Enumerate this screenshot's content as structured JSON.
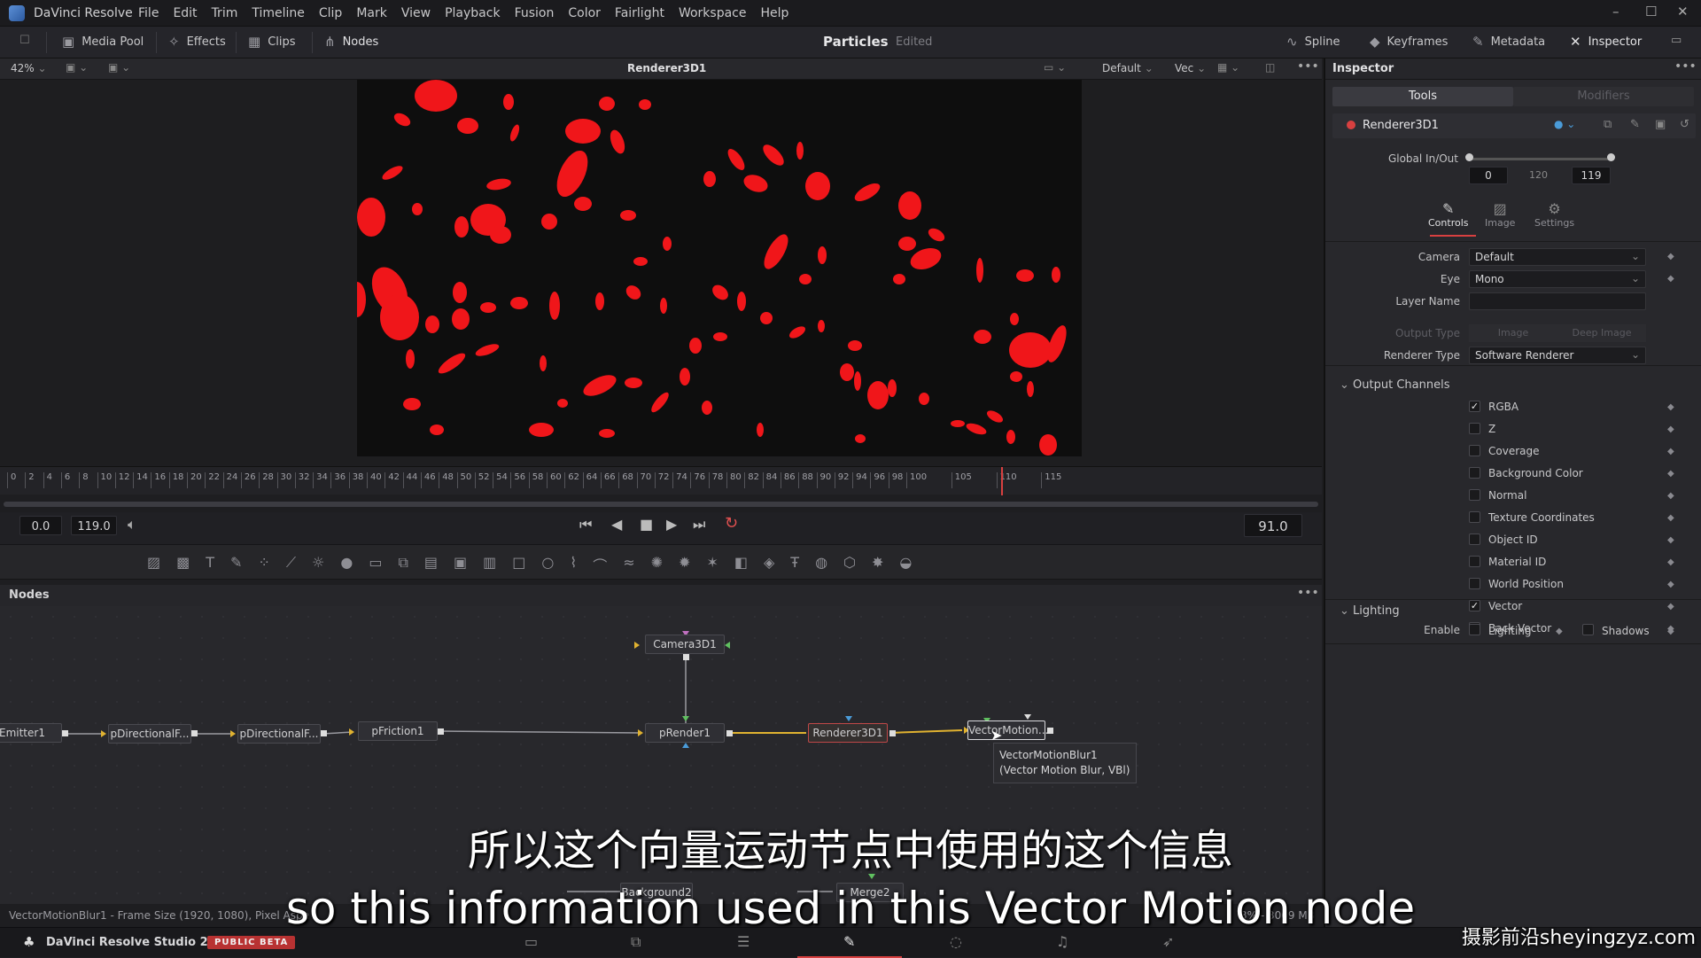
{
  "app": {
    "name": "DaVinci Resolve",
    "menus": [
      "File",
      "Edit",
      "Trim",
      "Timeline",
      "Clip",
      "Mark",
      "View",
      "Playback",
      "Fusion",
      "Color",
      "Fairlight",
      "Workspace",
      "Help"
    ]
  },
  "toolbar": {
    "media_pool": "Media Pool",
    "effects": "Effects",
    "clips": "Clips",
    "nodes": "Nodes",
    "project_title": "Particles",
    "project_status": "Edited",
    "spline": "Spline",
    "keyframes": "Keyframes",
    "metadata": "Metadata",
    "inspector": "Inspector"
  },
  "viewer": {
    "zoom": "42%",
    "title": "Renderer3D1",
    "lut": "Default",
    "vec": "Vec"
  },
  "ruler": {
    "ticks": [
      "0",
      "2",
      "4",
      "6",
      "8",
      "10",
      "12",
      "14",
      "16",
      "18",
      "20",
      "22",
      "24",
      "26",
      "28",
      "30",
      "32",
      "34",
      "36",
      "38",
      "40",
      "42",
      "44",
      "46",
      "48",
      "50",
      "52",
      "54",
      "56",
      "58",
      "60",
      "62",
      "64",
      "66",
      "68",
      "70",
      "72",
      "74",
      "76",
      "78",
      "80",
      "82",
      "84",
      "86",
      "88",
      "90",
      "92",
      "94",
      "96",
      "98",
      "100",
      "105",
      "110",
      "115"
    ]
  },
  "transport": {
    "start": "0.0",
    "end": "119.0",
    "current": "91.0"
  },
  "nodes_panel": {
    "title": "Nodes",
    "nodes": [
      "Camera3D1",
      "Emitter1",
      "pDirectionalF...",
      "pDirectionalF...",
      "pFriction1",
      "pRender1",
      "Renderer3D1",
      "VectorMotion...",
      "Background2",
      "Merge2"
    ],
    "tooltip_name": "VectorMotionBlur1",
    "tooltip_detail": "(Vector Motion Blur, VBl)"
  },
  "status": {
    "left": "VectorMotionBlur1 - Frame Size (1920, 1080), Pixel Aspe",
    "right": "3% - 3069 MB"
  },
  "bottom": {
    "product": "DaVinci Resolve Studio 20",
    "badge": "PUBLIC BETA"
  },
  "inspector": {
    "title": "Inspector",
    "tab_tools": "Tools",
    "tab_modifiers": "Modifiers",
    "tool_name": "Renderer3D1",
    "global_label": "Global In/Out",
    "global_in": "0",
    "global_mid": "120",
    "global_out": "119",
    "subtab_controls": "Controls",
    "subtab_image": "Image",
    "subtab_settings": "Settings",
    "camera_label": "Camera",
    "camera_value": "Default",
    "eye_label": "Eye",
    "eye_value": "Mono",
    "layer_label": "Layer Name",
    "layer_value": "",
    "output_type_label": "Output Type",
    "output_image": "Image",
    "output_deep": "Deep Image",
    "renderer_label": "Renderer Type",
    "renderer_value": "Software Renderer",
    "output_channels": "Output Channels",
    "channels": [
      {
        "label": "RGBA",
        "checked": "✓"
      },
      {
        "label": "Z",
        "checked": ""
      },
      {
        "label": "Coverage",
        "checked": ""
      },
      {
        "label": "Background Color",
        "checked": ""
      },
      {
        "label": "Normal",
        "checked": ""
      },
      {
        "label": "Texture Coordinates",
        "checked": ""
      },
      {
        "label": "Object ID",
        "checked": ""
      },
      {
        "label": "Material ID",
        "checked": ""
      },
      {
        "label": "World Position",
        "checked": ""
      },
      {
        "label": "Vector",
        "checked": "✓"
      },
      {
        "label": "Back Vector",
        "checked": ""
      }
    ],
    "lighting": "Lighting",
    "enable_label": "Enable",
    "lighting_cb": "Lighting",
    "shadows_cb": "Shadows"
  },
  "subtitles": {
    "zh": "所以这个向量运动节点中使用的这个信息",
    "en": "so this information used in this Vector Motion node"
  },
  "watermark": "摄影前沿sheyingzyz.com"
}
